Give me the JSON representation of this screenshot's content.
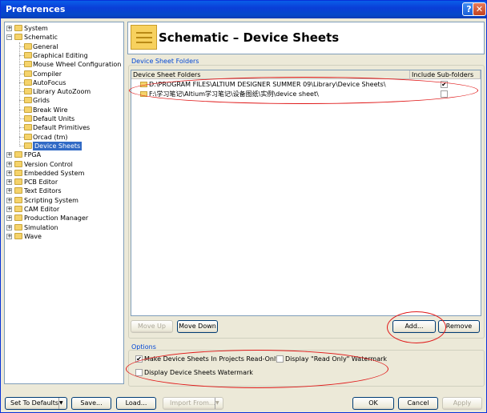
{
  "window": {
    "title": "Preferences",
    "help_glyph": "?",
    "close_glyph": "✕"
  },
  "tree": {
    "top_items": [
      "System",
      "Schematic",
      "FPGA",
      "Version Control",
      "Embedded System",
      "PCB Editor",
      "Text Editors",
      "Scripting System",
      "CAM Editor",
      "Production Manager",
      "Simulation",
      "Wave"
    ],
    "schematic_children": [
      "General",
      "Graphical Editing",
      "Mouse Wheel Configuration",
      "Compiler",
      "AutoFocus",
      "Library AutoZoom",
      "Grids",
      "Break Wire",
      "Default Units",
      "Default Primitives",
      "Orcad (tm)",
      "Device Sheets"
    ],
    "selected": "Device Sheets"
  },
  "header": {
    "title": "Schematic – Device Sheets"
  },
  "folders_group": {
    "label": "Device Sheet Folders",
    "columns": [
      "Device Sheet Folders",
      "Include Sub-folders"
    ],
    "rows": [
      {
        "path": "D:\\PROGRAM FILES\\ALTIUM DESIGNER SUMMER 09\\Library\\Device Sheets\\",
        "include_sub": true
      },
      {
        "path": "F:\\学习笔记\\Altium学习笔记\\设备图纸\\实例\\device sheet\\",
        "include_sub": false
      }
    ],
    "buttons": {
      "move_up": "Move Up",
      "move_down": "Move Down",
      "add": "Add...",
      "remove": "Remove"
    }
  },
  "options_group": {
    "label": "Options",
    "make_readonly": {
      "label": "Make Device Sheets In Projects Read-Only",
      "checked": true
    },
    "readonly_watermark": {
      "label": "Display \"Read Only\" Watermark",
      "checked": false
    },
    "sheets_watermark": {
      "label": "Display Device Sheets Watermark",
      "checked": false
    }
  },
  "footer": {
    "set_defaults": "Set To Defaults",
    "save": "Save...",
    "load": "Load...",
    "import_from": "Import From...",
    "ok": "OK",
    "cancel": "Cancel",
    "apply": "Apply",
    "dropdown_glyph": "▼"
  },
  "tree_glyphs": {
    "expand": "+",
    "collapse": "−"
  },
  "check_glyph": "✔",
  "annotation_color": "#e01818"
}
